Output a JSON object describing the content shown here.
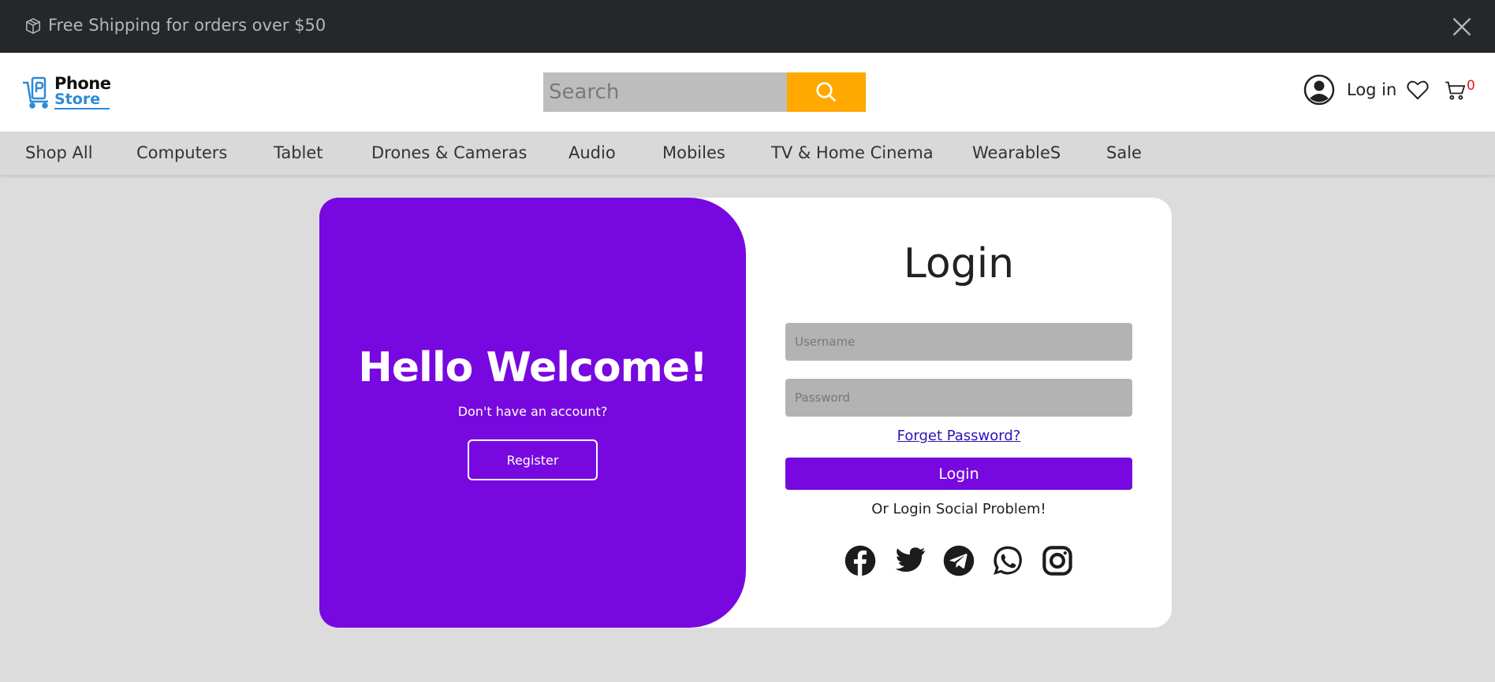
{
  "topbar": {
    "shipping_text": "Free Shipping for orders over $50"
  },
  "header": {
    "logo_line1": "Phone",
    "logo_line2": "Store",
    "search_placeholder": "Search",
    "login_label": "Log in",
    "cart_count": "0"
  },
  "nav": {
    "items": [
      "Shop All",
      "Computers",
      "Tablet",
      "Drones & Cameras",
      "Audio",
      "Mobiles",
      "TV & Home Cinema",
      "WearableS",
      "Sale"
    ]
  },
  "welcome": {
    "title": "Hello Welcome!",
    "subtitle": "Don't have an account?",
    "register_label": "Register"
  },
  "login": {
    "title": "Login",
    "username_placeholder": "Username",
    "password_placeholder": "Password",
    "forget_label": "Forget Password?",
    "submit_label": "Login",
    "social_text": "Or Login Social Problem!",
    "social_icons": [
      "facebook-icon",
      "twitter-icon",
      "telegram-icon",
      "whatsapp-icon",
      "instagram-icon"
    ]
  },
  "colors": {
    "topbar_bg": "#25272b",
    "accent_purple": "#7808e0",
    "search_button": "#fea800",
    "cart_badge": "#e8131c"
  }
}
